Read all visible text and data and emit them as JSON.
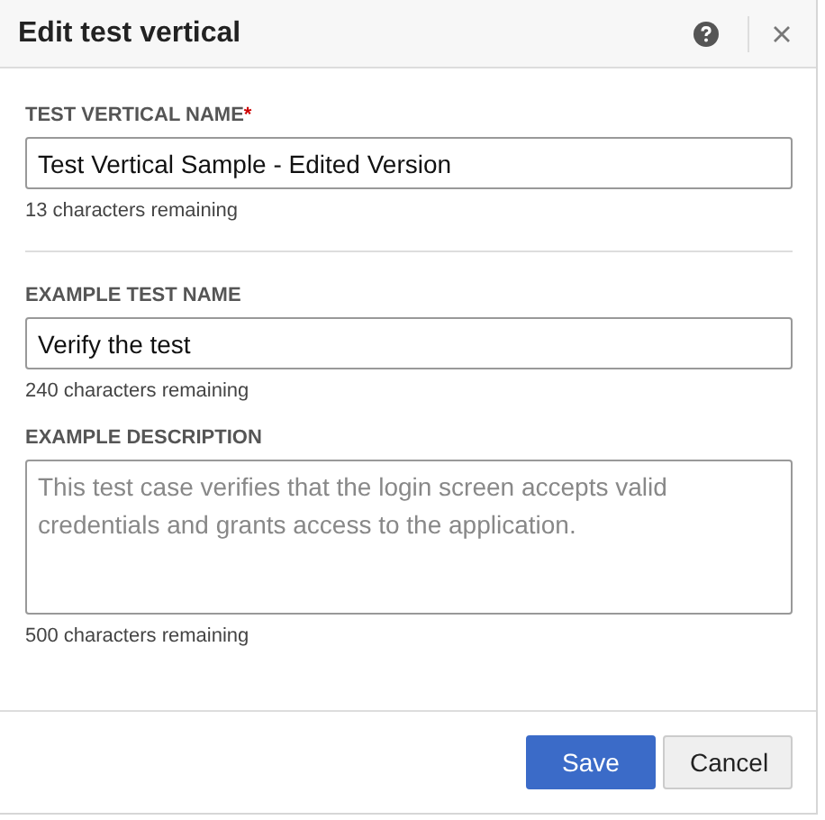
{
  "dialog": {
    "title": "Edit test vertical"
  },
  "sections": [
    {
      "fields": [
        {
          "kind": "input",
          "label": "TEST VERTICAL NAME",
          "required_mark": "*",
          "value": "Test Vertical Sample - Edited Version",
          "hint": "13 characters remaining"
        }
      ]
    },
    {
      "fields": [
        {
          "kind": "input",
          "label": "EXAMPLE TEST NAME",
          "value": "Verify the test",
          "hint": "240 characters remaining"
        },
        {
          "kind": "textarea",
          "label": "EXAMPLE DESCRIPTION",
          "placeholder": "This test case verifies that the login screen accepts valid credentials and grants access to the application.",
          "hint": "500 characters remaining"
        }
      ]
    }
  ],
  "buttons": [
    {
      "label": "Save",
      "kind": "primary"
    },
    {
      "label": "Cancel",
      "kind": "secondary"
    }
  ]
}
